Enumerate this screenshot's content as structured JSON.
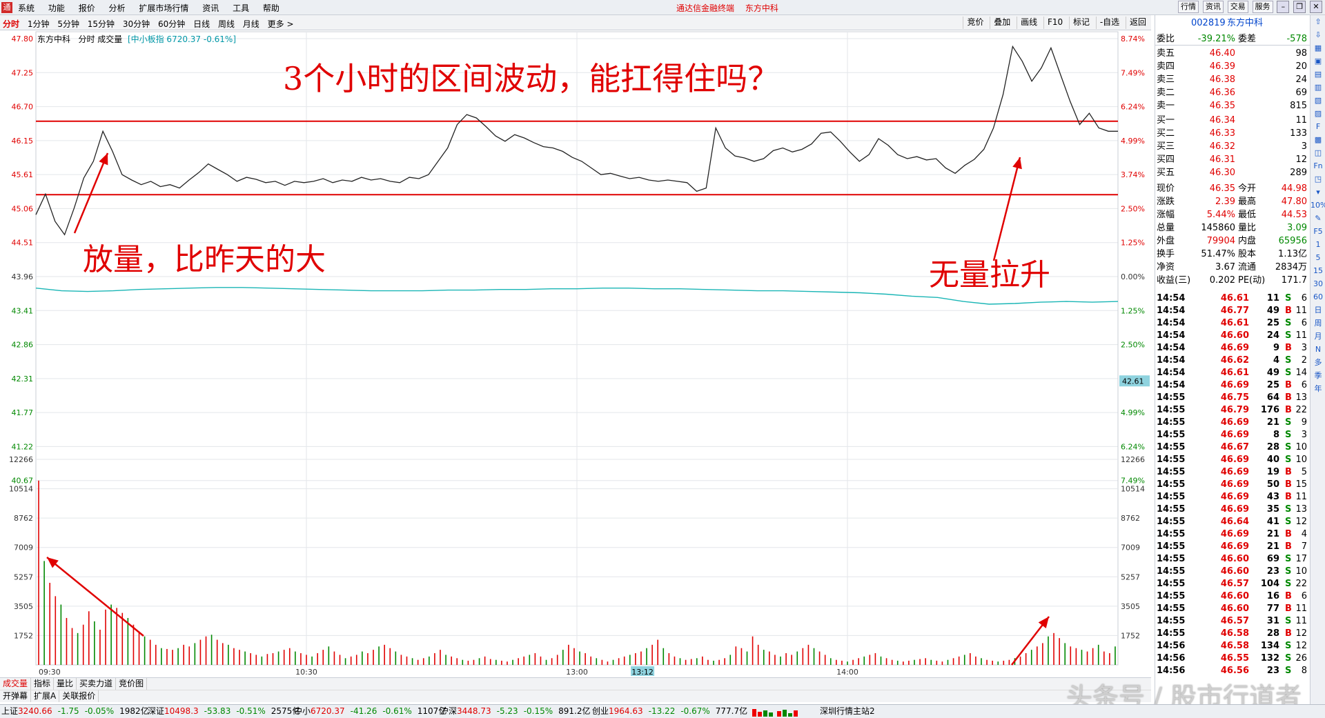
{
  "menubar": {
    "logo": "通",
    "items": [
      "系统",
      "功能",
      "报价",
      "分析",
      "扩展市场行情",
      "资讯",
      "工具",
      "帮助"
    ],
    "app_title": "通达信金融终端",
    "stock_title": "东方中科",
    "right_buttons": [
      "行情",
      "资讯",
      "交易",
      "服务"
    ]
  },
  "timeframes": {
    "items": [
      "分时",
      "1分钟",
      "5分钟",
      "15分钟",
      "30分钟",
      "60分钟",
      "日线",
      "周线",
      "月线",
      "更多 >"
    ],
    "selected": "分时",
    "tools": [
      "竞价",
      "叠加",
      "画线",
      "F10",
      "标记",
      "-自选",
      "返回"
    ]
  },
  "info": {
    "name": "东方中科",
    "mode": "分时 成交量",
    "index": "[中小板指 6720.37 -0.61%]"
  },
  "annotations": {
    "title": "3个小时的区间波动，能扛得住吗？",
    "left_note": "放量，比昨天的大",
    "right_note": "无量拉升"
  },
  "chart_data": {
    "type": "line",
    "title": "",
    "price_ticks": [
      "47.80",
      "47.25",
      "46.70",
      "46.15",
      "45.61",
      "45.06",
      "44.51",
      "43.96",
      "43.41",
      "42.86",
      "42.31",
      "41.77",
      "41.22",
      "40.67"
    ],
    "pct_ticks": [
      "8.74%",
      "7.49%",
      "6.24%",
      "4.99%",
      "3.74%",
      "2.50%",
      "1.25%",
      "0.00%",
      "1.25%",
      "2.50%",
      "3.74%",
      "4.99%",
      "6.24%",
      "7.49%"
    ],
    "volume_ticks": [
      "12266",
      "10514",
      "8762",
      "7009",
      "5257",
      "3505",
      "1752"
    ],
    "time_ticks": [
      "09:30",
      "10:30",
      "13:00",
      "14:00"
    ],
    "cursor_time": "13:12",
    "cursor_price": "42.61",
    "prev_close": 43.96,
    "ylim": [
      40.67,
      47.8
    ],
    "support_line": 45.4,
    "resistance_line": 46.5,
    "series": [
      {
        "values": [
          45.1,
          45.41,
          45.0,
          44.8,
          45.2,
          45.65,
          45.9,
          46.35,
          46.05,
          45.7,
          45.62,
          45.55,
          45.6,
          45.52,
          45.55,
          45.5,
          45.62,
          45.73,
          45.86,
          45.78,
          45.7,
          45.6,
          45.66,
          45.63,
          45.58,
          45.6,
          45.54,
          45.6,
          45.58,
          45.6,
          45.64,
          45.58,
          45.62,
          45.6,
          45.66,
          45.62,
          45.64,
          45.6,
          45.58,
          45.66,
          45.64,
          45.7,
          45.9,
          46.1,
          46.45,
          46.6,
          46.55,
          46.42,
          46.28,
          46.2,
          46.3,
          46.25,
          46.18,
          46.12,
          46.1,
          46.05,
          45.96,
          45.9,
          45.8,
          45.7,
          45.72,
          45.68,
          45.64,
          45.66,
          45.62,
          45.6,
          45.62,
          45.6,
          45.58,
          45.45,
          45.5,
          46.4,
          46.1,
          45.98,
          45.95,
          45.9,
          45.94,
          46.06,
          46.1,
          46.04,
          46.08,
          46.16,
          46.32,
          46.34,
          46.2,
          46.04,
          45.9,
          46.0,
          46.24,
          46.14,
          46.0,
          45.94,
          45.97,
          45.92,
          45.94,
          45.8,
          45.72,
          45.84,
          45.93,
          46.08,
          46.4,
          46.9,
          47.62,
          47.4,
          47.1,
          47.3,
          47.6,
          47.2,
          46.8,
          46.45,
          46.62,
          46.4,
          46.35,
          46.35
        ],
        "avg": [
          44.0,
          43.96,
          43.95,
          43.96,
          43.98,
          43.99,
          44.0,
          44.01,
          44.01,
          44.0,
          43.99,
          43.98,
          43.97,
          43.96,
          43.96,
          43.96,
          43.97,
          43.97,
          43.98,
          43.98,
          43.99,
          43.99,
          44.0,
          44.0,
          43.99,
          43.99,
          43.98,
          43.97,
          43.96,
          43.96,
          43.95,
          43.94,
          43.93,
          43.91,
          43.88,
          43.86,
          43.8,
          43.76,
          43.77,
          43.79,
          43.8,
          43.79,
          43.8
        ]
      }
    ],
    "volume": [
      11000,
      6200,
      4900,
      4100,
      3600,
      2800,
      2200,
      1900,
      2400,
      3200,
      2600,
      2100,
      3300,
      3600,
      3400,
      3100,
      2800,
      2400,
      2000,
      1700,
      1500,
      1200,
      1000,
      950,
      900,
      1000,
      1200,
      1100,
      1300,
      1500,
      1700,
      1800,
      1500,
      1300,
      1200,
      1000,
      900,
      800,
      700,
      600,
      500,
      650,
      700,
      800,
      900,
      1000,
      800,
      700,
      600,
      500,
      700,
      900,
      1100,
      800,
      600,
      400,
      500,
      600,
      800,
      700,
      900,
      1100,
      1200,
      1000,
      800,
      600,
      500,
      400,
      300,
      400,
      500,
      700,
      900,
      600,
      500,
      400,
      300,
      250,
      300,
      400,
      500,
      350,
      300,
      250,
      200,
      300,
      400,
      500,
      600,
      700,
      500,
      300,
      400,
      600,
      900,
      1200,
      1000,
      800,
      700,
      500,
      400,
      300,
      200,
      300,
      400,
      500,
      600,
      700,
      800,
      1000,
      1200,
      1500,
      1000,
      700,
      500,
      400,
      300,
      350,
      400,
      500,
      300,
      250,
      300,
      400,
      600,
      1100,
      1000,
      800,
      1700,
      1200,
      900,
      800,
      600,
      500,
      700,
      600,
      800,
      1000,
      1200,
      1000,
      800,
      600,
      400,
      300,
      250,
      200,
      300,
      400,
      500,
      600,
      700,
      500,
      400,
      300,
      250,
      200,
      250,
      300,
      350,
      400,
      300,
      250,
      200,
      300,
      400,
      500,
      600,
      700,
      500,
      400,
      300,
      250,
      200,
      250,
      300,
      400,
      500,
      700,
      900,
      1100,
      1300,
      1700,
      1900,
      1600,
      1300,
      1100,
      1000,
      900,
      800,
      1000,
      1200,
      800,
      700,
      1100
    ]
  },
  "quote_header": {
    "code": "002819",
    "name": "东方中科"
  },
  "weibi": {
    "label": "委比",
    "value": "-39.21%",
    "label2": "委差",
    "value2": "-578"
  },
  "asks": [
    {
      "label": "卖五",
      "price": "46.40",
      "vol": "98"
    },
    {
      "label": "卖四",
      "price": "46.39",
      "vol": "20"
    },
    {
      "label": "卖三",
      "price": "46.38",
      "vol": "24"
    },
    {
      "label": "卖二",
      "price": "46.36",
      "vol": "69"
    },
    {
      "label": "卖一",
      "price": "46.35",
      "vol": "815"
    }
  ],
  "bids": [
    {
      "label": "买一",
      "price": "46.34",
      "vol": "11"
    },
    {
      "label": "买二",
      "price": "46.33",
      "vol": "133"
    },
    {
      "label": "买三",
      "price": "46.32",
      "vol": "3"
    },
    {
      "label": "买四",
      "price": "46.31",
      "vol": "12"
    },
    {
      "label": "买五",
      "price": "46.30",
      "vol": "289"
    }
  ],
  "stats": [
    {
      "l": "现价",
      "v": "46.35",
      "vc": "red",
      "l2": "今开",
      "v2": "44.98",
      "v2c": "red"
    },
    {
      "l": "涨跌",
      "v": "2.39",
      "vc": "red",
      "l2": "最高",
      "v2": "47.80",
      "v2c": "red"
    },
    {
      "l": "涨幅",
      "v": "5.44%",
      "vc": "red",
      "l2": "最低",
      "v2": "44.53",
      "v2c": "red"
    },
    {
      "l": "总量",
      "v": "145860",
      "vc": "black",
      "l2": "量比",
      "v2": "3.09",
      "v2c": "green"
    },
    {
      "l": "外盘",
      "v": "79904",
      "vc": "red",
      "l2": "内盘",
      "v2": "65956",
      "v2c": "green"
    },
    {
      "l": "换手",
      "v": "51.47%",
      "vc": "black",
      "l2": "股本",
      "v2": "1.13亿",
      "v2c": "black"
    },
    {
      "l": "净资",
      "v": "3.67",
      "vc": "black",
      "l2": "流通",
      "v2": "2834万",
      "v2c": "black"
    },
    {
      "l": "收益(三)",
      "v": "0.202",
      "vc": "black",
      "l2": "PE(动)",
      "v2": "171.7",
      "v2c": "black"
    }
  ],
  "ticks": [
    {
      "t": "14:54",
      "p": "46.61",
      "q": "11",
      "bs": "S",
      "n": "6"
    },
    {
      "t": "14:54",
      "p": "46.77",
      "q": "49",
      "bs": "B",
      "n": "11"
    },
    {
      "t": "14:54",
      "p": "46.61",
      "q": "25",
      "bs": "S",
      "n": "6"
    },
    {
      "t": "14:54",
      "p": "46.60",
      "q": "24",
      "bs": "S",
      "n": "11"
    },
    {
      "t": "14:54",
      "p": "46.69",
      "q": "9",
      "bs": "B",
      "n": "3"
    },
    {
      "t": "14:54",
      "p": "46.62",
      "q": "4",
      "bs": "S",
      "n": "2"
    },
    {
      "t": "14:54",
      "p": "46.61",
      "q": "49",
      "bs": "S",
      "n": "14"
    },
    {
      "t": "14:54",
      "p": "46.69",
      "q": "25",
      "bs": "B",
      "n": "6"
    },
    {
      "t": "14:55",
      "p": "46.75",
      "q": "64",
      "bs": "B",
      "n": "13"
    },
    {
      "t": "14:55",
      "p": "46.79",
      "q": "176",
      "bs": "B",
      "n": "22"
    },
    {
      "t": "14:55",
      "p": "46.69",
      "q": "21",
      "bs": "S",
      "n": "9"
    },
    {
      "t": "14:55",
      "p": "46.69",
      "q": "8",
      "bs": "S",
      "n": "3"
    },
    {
      "t": "14:55",
      "p": "46.67",
      "q": "28",
      "bs": "S",
      "n": "10"
    },
    {
      "t": "14:55",
      "p": "46.69",
      "q": "40",
      "bs": "S",
      "n": "10"
    },
    {
      "t": "14:55",
      "p": "46.69",
      "q": "19",
      "bs": "B",
      "n": "5"
    },
    {
      "t": "14:55",
      "p": "46.69",
      "q": "50",
      "bs": "B",
      "n": "15"
    },
    {
      "t": "14:55",
      "p": "46.69",
      "q": "43",
      "bs": "B",
      "n": "11"
    },
    {
      "t": "14:55",
      "p": "46.69",
      "q": "35",
      "bs": "S",
      "n": "13"
    },
    {
      "t": "14:55",
      "p": "46.64",
      "q": "41",
      "bs": "S",
      "n": "12"
    },
    {
      "t": "14:55",
      "p": "46.69",
      "q": "21",
      "bs": "B",
      "n": "4"
    },
    {
      "t": "14:55",
      "p": "46.69",
      "q": "21",
      "bs": "B",
      "n": "7"
    },
    {
      "t": "14:55",
      "p": "46.60",
      "q": "69",
      "bs": "S",
      "n": "17"
    },
    {
      "t": "14:55",
      "p": "46.60",
      "q": "23",
      "bs": "S",
      "n": "10"
    },
    {
      "t": "14:55",
      "p": "46.57",
      "q": "104",
      "bs": "S",
      "n": "22"
    },
    {
      "t": "14:55",
      "p": "46.60",
      "q": "16",
      "bs": "B",
      "n": "6"
    },
    {
      "t": "14:55",
      "p": "46.60",
      "q": "77",
      "bs": "B",
      "n": "11"
    },
    {
      "t": "14:55",
      "p": "46.57",
      "q": "31",
      "bs": "S",
      "n": "11"
    },
    {
      "t": "14:55",
      "p": "46.58",
      "q": "28",
      "bs": "B",
      "n": "12"
    },
    {
      "t": "14:56",
      "p": "46.58",
      "q": "134",
      "bs": "S",
      "n": "12"
    },
    {
      "t": "14:56",
      "p": "46.55",
      "q": "132",
      "bs": "S",
      "n": "26"
    },
    {
      "t": "14:56",
      "p": "46.56",
      "q": "23",
      "bs": "S",
      "n": "8"
    }
  ],
  "side_icons": [
    "⇧",
    "⇩",
    "▦",
    "▣",
    "▤",
    "▥",
    "▧",
    "▨",
    "F",
    "▩",
    "◫",
    "Fn",
    "◳",
    "▾",
    "10%",
    "✎",
    "F5",
    "1",
    "5",
    "15",
    "30",
    "60",
    "日",
    "周",
    "月",
    "N",
    "多",
    "季",
    "年"
  ],
  "bottom_tabs1": [
    "成交量",
    "指标",
    "量比",
    "买卖力道",
    "竞价图"
  ],
  "bottom_tabs2": [
    "开弹幕",
    "扩展A",
    "关联报价"
  ],
  "status": [
    {
      "name": "上证",
      "v": "3240.66",
      "c": "-1.75",
      "p": "-0.05%",
      "a": "1982亿"
    },
    {
      "name": "深证",
      "v": "10498.3",
      "c": "-53.83",
      "p": "-0.51%",
      "a": "2575亿"
    },
    {
      "name": "中小",
      "v": "6720.37",
      "c": "-41.26",
      "p": "-0.61%",
      "a": "1107亿"
    },
    {
      "name": "沪深",
      "v": "3448.73",
      "c": "-5.23",
      "p": "-0.15%",
      "a": "891.2亿"
    },
    {
      "name": "创业",
      "v": "1964.63",
      "c": "-13.22",
      "p": "-0.67%",
      "a": "777.7亿"
    }
  ],
  "status_station": "深圳行情主站2",
  "watermark": "头条号 / 股市行道者"
}
